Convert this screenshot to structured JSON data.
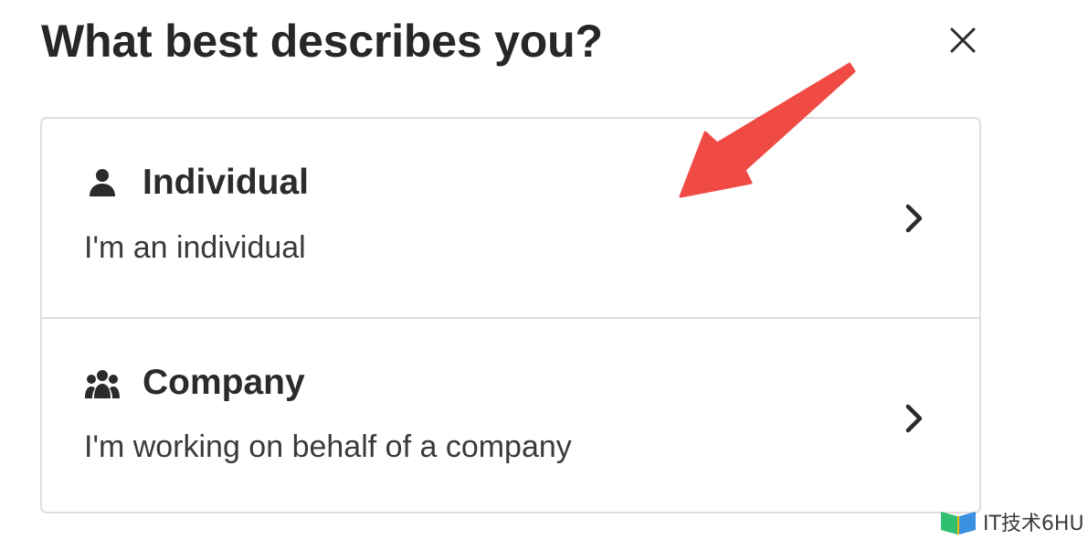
{
  "dialog": {
    "title": "What best describes you?",
    "close_icon": "close-icon"
  },
  "options": [
    {
      "icon": "person-icon",
      "title": "Individual",
      "description": "I'm an individual",
      "chevron_icon": "chevron-right-icon"
    },
    {
      "icon": "group-icon",
      "title": "Company",
      "description": "I'm working on behalf of a company",
      "chevron_icon": "chevron-right-icon"
    }
  ],
  "annotation": {
    "arrow_color": "#f04a45"
  },
  "watermark": {
    "text": "IT技术6HU"
  }
}
